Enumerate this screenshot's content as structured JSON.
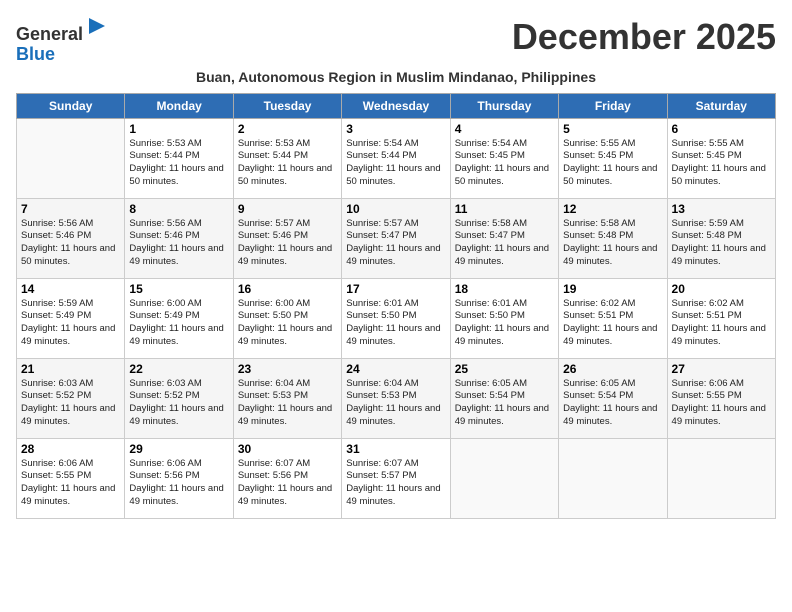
{
  "header": {
    "logo_general": "General",
    "logo_blue": "Blue",
    "month_title": "December 2025",
    "subtitle": "Buan, Autonomous Region in Muslim Mindanao, Philippines"
  },
  "days_of_week": [
    "Sunday",
    "Monday",
    "Tuesday",
    "Wednesday",
    "Thursday",
    "Friday",
    "Saturday"
  ],
  "weeks": [
    [
      {
        "day": "",
        "sunrise": "",
        "sunset": "",
        "daylight": ""
      },
      {
        "day": "1",
        "sunrise": "Sunrise: 5:53 AM",
        "sunset": "Sunset: 5:44 PM",
        "daylight": "Daylight: 11 hours and 50 minutes."
      },
      {
        "day": "2",
        "sunrise": "Sunrise: 5:53 AM",
        "sunset": "Sunset: 5:44 PM",
        "daylight": "Daylight: 11 hours and 50 minutes."
      },
      {
        "day": "3",
        "sunrise": "Sunrise: 5:54 AM",
        "sunset": "Sunset: 5:44 PM",
        "daylight": "Daylight: 11 hours and 50 minutes."
      },
      {
        "day": "4",
        "sunrise": "Sunrise: 5:54 AM",
        "sunset": "Sunset: 5:45 PM",
        "daylight": "Daylight: 11 hours and 50 minutes."
      },
      {
        "day": "5",
        "sunrise": "Sunrise: 5:55 AM",
        "sunset": "Sunset: 5:45 PM",
        "daylight": "Daylight: 11 hours and 50 minutes."
      },
      {
        "day": "6",
        "sunrise": "Sunrise: 5:55 AM",
        "sunset": "Sunset: 5:45 PM",
        "daylight": "Daylight: 11 hours and 50 minutes."
      }
    ],
    [
      {
        "day": "7",
        "sunrise": "Sunrise: 5:56 AM",
        "sunset": "Sunset: 5:46 PM",
        "daylight": "Daylight: 11 hours and 50 minutes."
      },
      {
        "day": "8",
        "sunrise": "Sunrise: 5:56 AM",
        "sunset": "Sunset: 5:46 PM",
        "daylight": "Daylight: 11 hours and 49 minutes."
      },
      {
        "day": "9",
        "sunrise": "Sunrise: 5:57 AM",
        "sunset": "Sunset: 5:46 PM",
        "daylight": "Daylight: 11 hours and 49 minutes."
      },
      {
        "day": "10",
        "sunrise": "Sunrise: 5:57 AM",
        "sunset": "Sunset: 5:47 PM",
        "daylight": "Daylight: 11 hours and 49 minutes."
      },
      {
        "day": "11",
        "sunrise": "Sunrise: 5:58 AM",
        "sunset": "Sunset: 5:47 PM",
        "daylight": "Daylight: 11 hours and 49 minutes."
      },
      {
        "day": "12",
        "sunrise": "Sunrise: 5:58 AM",
        "sunset": "Sunset: 5:48 PM",
        "daylight": "Daylight: 11 hours and 49 minutes."
      },
      {
        "day": "13",
        "sunrise": "Sunrise: 5:59 AM",
        "sunset": "Sunset: 5:48 PM",
        "daylight": "Daylight: 11 hours and 49 minutes."
      }
    ],
    [
      {
        "day": "14",
        "sunrise": "Sunrise: 5:59 AM",
        "sunset": "Sunset: 5:49 PM",
        "daylight": "Daylight: 11 hours and 49 minutes."
      },
      {
        "day": "15",
        "sunrise": "Sunrise: 6:00 AM",
        "sunset": "Sunset: 5:49 PM",
        "daylight": "Daylight: 11 hours and 49 minutes."
      },
      {
        "day": "16",
        "sunrise": "Sunrise: 6:00 AM",
        "sunset": "Sunset: 5:50 PM",
        "daylight": "Daylight: 11 hours and 49 minutes."
      },
      {
        "day": "17",
        "sunrise": "Sunrise: 6:01 AM",
        "sunset": "Sunset: 5:50 PM",
        "daylight": "Daylight: 11 hours and 49 minutes."
      },
      {
        "day": "18",
        "sunrise": "Sunrise: 6:01 AM",
        "sunset": "Sunset: 5:50 PM",
        "daylight": "Daylight: 11 hours and 49 minutes."
      },
      {
        "day": "19",
        "sunrise": "Sunrise: 6:02 AM",
        "sunset": "Sunset: 5:51 PM",
        "daylight": "Daylight: 11 hours and 49 minutes."
      },
      {
        "day": "20",
        "sunrise": "Sunrise: 6:02 AM",
        "sunset": "Sunset: 5:51 PM",
        "daylight": "Daylight: 11 hours and 49 minutes."
      }
    ],
    [
      {
        "day": "21",
        "sunrise": "Sunrise: 6:03 AM",
        "sunset": "Sunset: 5:52 PM",
        "daylight": "Daylight: 11 hours and 49 minutes."
      },
      {
        "day": "22",
        "sunrise": "Sunrise: 6:03 AM",
        "sunset": "Sunset: 5:52 PM",
        "daylight": "Daylight: 11 hours and 49 minutes."
      },
      {
        "day": "23",
        "sunrise": "Sunrise: 6:04 AM",
        "sunset": "Sunset: 5:53 PM",
        "daylight": "Daylight: 11 hours and 49 minutes."
      },
      {
        "day": "24",
        "sunrise": "Sunrise: 6:04 AM",
        "sunset": "Sunset: 5:53 PM",
        "daylight": "Daylight: 11 hours and 49 minutes."
      },
      {
        "day": "25",
        "sunrise": "Sunrise: 6:05 AM",
        "sunset": "Sunset: 5:54 PM",
        "daylight": "Daylight: 11 hours and 49 minutes."
      },
      {
        "day": "26",
        "sunrise": "Sunrise: 6:05 AM",
        "sunset": "Sunset: 5:54 PM",
        "daylight": "Daylight: 11 hours and 49 minutes."
      },
      {
        "day": "27",
        "sunrise": "Sunrise: 6:06 AM",
        "sunset": "Sunset: 5:55 PM",
        "daylight": "Daylight: 11 hours and 49 minutes."
      }
    ],
    [
      {
        "day": "28",
        "sunrise": "Sunrise: 6:06 AM",
        "sunset": "Sunset: 5:55 PM",
        "daylight": "Daylight: 11 hours and 49 minutes."
      },
      {
        "day": "29",
        "sunrise": "Sunrise: 6:06 AM",
        "sunset": "Sunset: 5:56 PM",
        "daylight": "Daylight: 11 hours and 49 minutes."
      },
      {
        "day": "30",
        "sunrise": "Sunrise: 6:07 AM",
        "sunset": "Sunset: 5:56 PM",
        "daylight": "Daylight: 11 hours and 49 minutes."
      },
      {
        "day": "31",
        "sunrise": "Sunrise: 6:07 AM",
        "sunset": "Sunset: 5:57 PM",
        "daylight": "Daylight: 11 hours and 49 minutes."
      },
      {
        "day": "",
        "sunrise": "",
        "sunset": "",
        "daylight": ""
      },
      {
        "day": "",
        "sunrise": "",
        "sunset": "",
        "daylight": ""
      },
      {
        "day": "",
        "sunrise": "",
        "sunset": "",
        "daylight": ""
      }
    ]
  ]
}
